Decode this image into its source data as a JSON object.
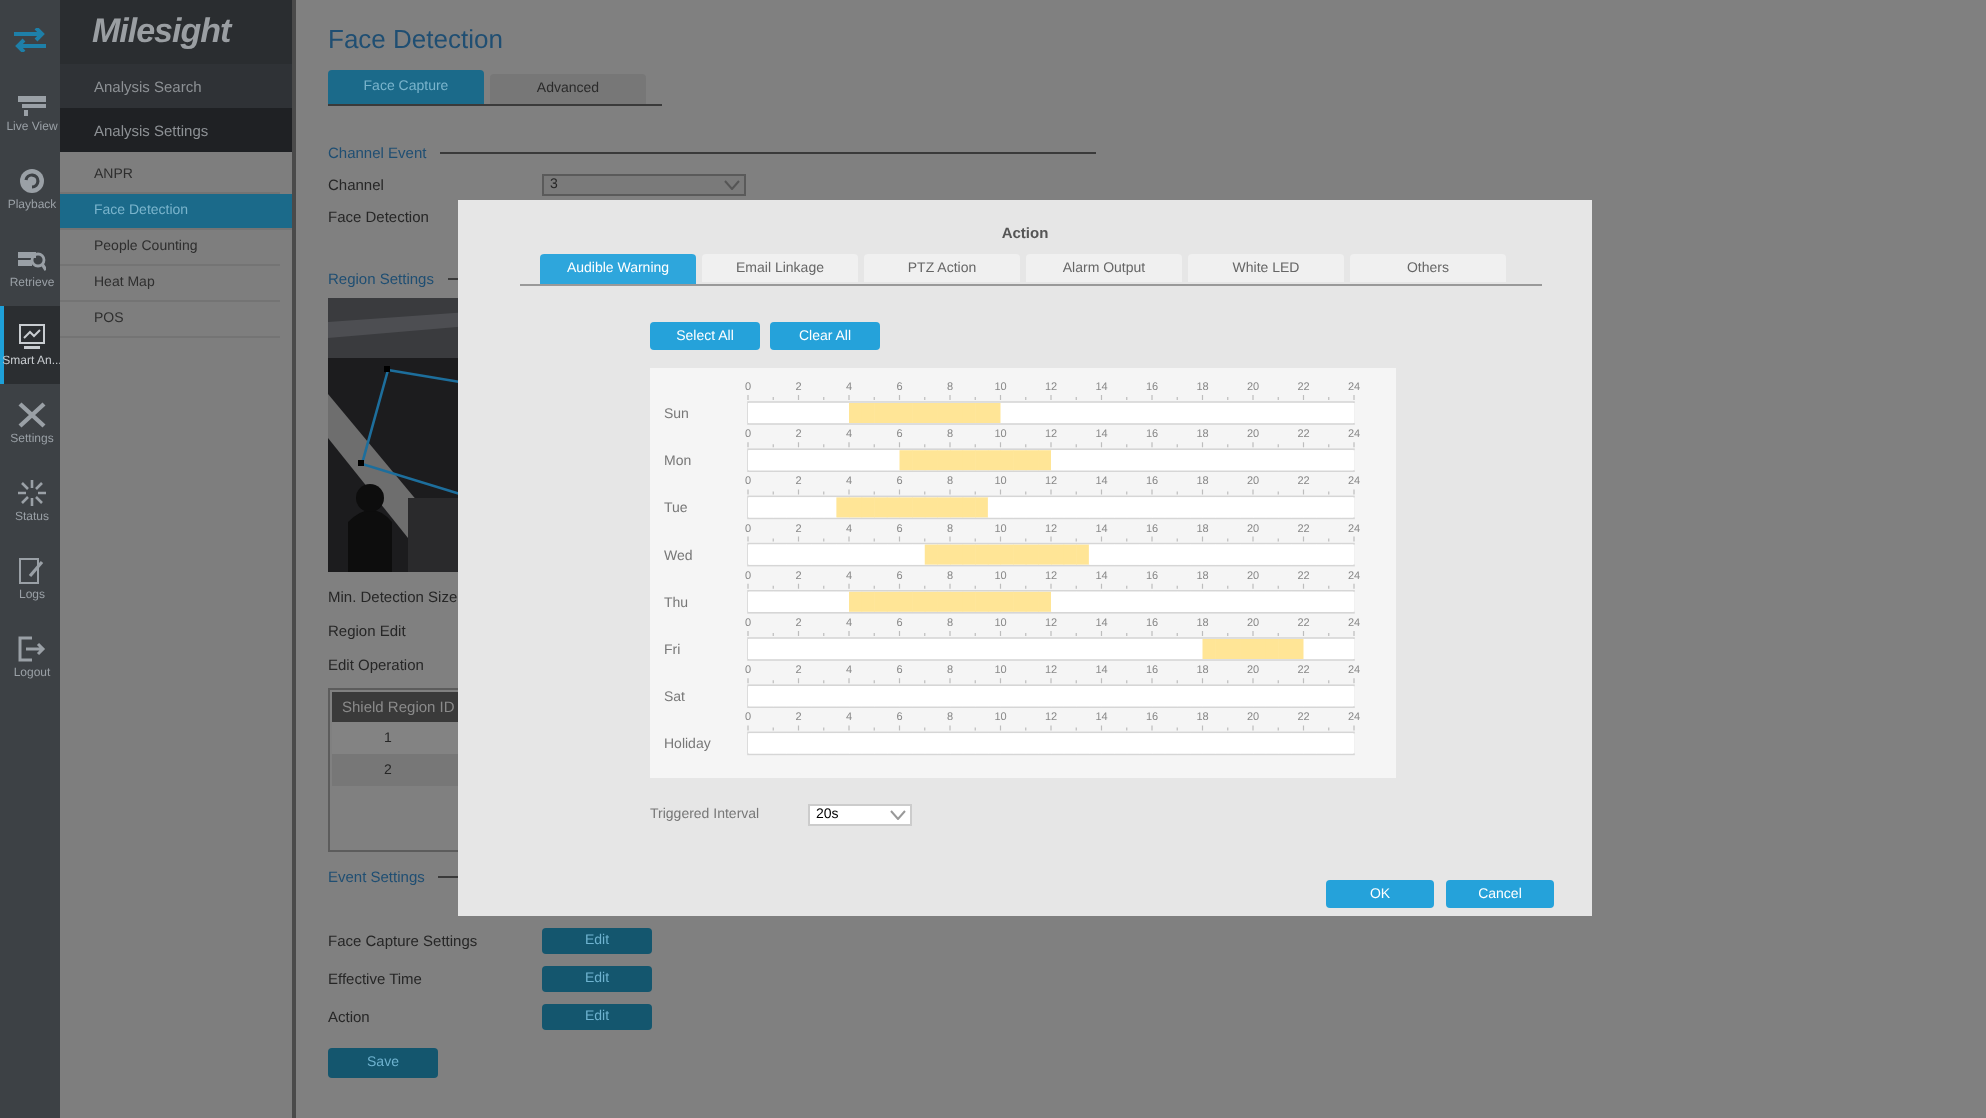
{
  "sidebar": {
    "items": [
      {
        "kind": "live",
        "label": "Live View",
        "selected": false
      },
      {
        "kind": "playback",
        "label": "Playback",
        "selected": false
      },
      {
        "kind": "retrieve",
        "label": "Retrieve",
        "selected": false
      },
      {
        "kind": "smart",
        "label": "Smart An...",
        "selected": true
      },
      {
        "kind": "settings",
        "label": "Settings",
        "selected": false
      },
      {
        "kind": "status",
        "label": "Status",
        "selected": false
      },
      {
        "kind": "logs",
        "label": "Logs",
        "selected": false
      },
      {
        "kind": "logout",
        "label": "Logout",
        "selected": false
      }
    ]
  },
  "menu": {
    "logo": "Milesight",
    "sections": [
      {
        "label": "Analysis Search",
        "selected": false
      },
      {
        "label": "Analysis Settings",
        "selected": true
      }
    ],
    "items": [
      {
        "label": "ANPR",
        "selected": false
      },
      {
        "label": "Face Detection",
        "selected": true
      },
      {
        "label": "People Counting",
        "selected": false
      },
      {
        "label": "Heat Map",
        "selected": false
      },
      {
        "label": "POS",
        "selected": false
      }
    ]
  },
  "page": {
    "title": "Face Detection",
    "tabs": [
      {
        "label": "Face Capture",
        "selected": true
      },
      {
        "label": "Advanced",
        "selected": false
      }
    ],
    "channel_event": {
      "heading": "Channel Event",
      "channel_label": "Channel",
      "channel_value": "3",
      "face_detection_label": "Face Detection"
    },
    "region_settings": {
      "heading": "Region Settings",
      "labels": [
        "Min. Detection Size",
        "Region Edit",
        "Edit Operation"
      ],
      "table": {
        "columns": [
          "Shield Region ID"
        ],
        "rows": [
          [
            "1"
          ],
          [
            "2"
          ]
        ]
      }
    },
    "event_settings": {
      "heading": "Event Settings",
      "rows": [
        {
          "label": "Face Capture Settings",
          "button": "Edit"
        },
        {
          "label": "Effective Time",
          "button": "Edit"
        },
        {
          "label": "Action",
          "button": "Edit"
        }
      ]
    },
    "save": "Save"
  },
  "dialog": {
    "title": "Action",
    "tabs": [
      {
        "label": "Audible Warning",
        "selected": true
      },
      {
        "label": "Email Linkage",
        "selected": false
      },
      {
        "label": "PTZ Action",
        "selected": false
      },
      {
        "label": "Alarm Output",
        "selected": false
      },
      {
        "label": "White LED",
        "selected": false
      },
      {
        "label": "Others",
        "selected": false
      }
    ],
    "buttons": [
      "Select All",
      "Clear All"
    ],
    "schedule": {
      "days": [
        {
          "label": "Sun",
          "ticks": [
            "0",
            "2",
            "4",
            "6",
            "8",
            "10",
            "12",
            "14",
            "16",
            "18",
            "20",
            "22",
            "24"
          ],
          "half_hours": [
            false,
            false,
            false,
            false,
            false,
            false,
            false,
            false,
            true,
            true,
            true,
            true,
            true,
            true,
            true,
            true,
            true,
            true,
            true,
            true,
            false,
            false,
            false,
            false,
            false,
            false,
            false,
            false,
            false,
            false,
            false,
            false,
            false,
            false,
            false,
            false,
            false,
            false,
            false,
            false,
            false,
            false,
            false,
            false,
            false,
            false,
            false,
            false
          ]
        },
        {
          "label": "Mon",
          "ticks": [
            "0",
            "2",
            "4",
            "6",
            "8",
            "10",
            "12",
            "14",
            "16",
            "18",
            "20",
            "22",
            "24"
          ],
          "half_hours": [
            false,
            false,
            false,
            false,
            false,
            false,
            false,
            false,
            false,
            false,
            false,
            false,
            true,
            true,
            true,
            true,
            true,
            true,
            true,
            true,
            true,
            true,
            true,
            true,
            false,
            false,
            false,
            false,
            false,
            false,
            false,
            false,
            false,
            false,
            false,
            false,
            false,
            false,
            false,
            false,
            false,
            false,
            false,
            false,
            false,
            false,
            false,
            false
          ]
        },
        {
          "label": "Tue",
          "ticks": [
            "0",
            "2",
            "4",
            "6",
            "8",
            "10",
            "12",
            "14",
            "16",
            "18",
            "20",
            "22",
            "24"
          ],
          "half_hours": [
            false,
            false,
            false,
            false,
            false,
            false,
            false,
            true,
            true,
            true,
            true,
            true,
            true,
            true,
            true,
            true,
            true,
            true,
            true,
            false,
            false,
            false,
            false,
            false,
            false,
            false,
            false,
            false,
            false,
            false,
            false,
            false,
            false,
            false,
            false,
            false,
            false,
            false,
            false,
            false,
            false,
            false,
            false,
            false,
            false,
            false,
            false,
            false
          ]
        },
        {
          "label": "Wed",
          "ticks": [
            "0",
            "2",
            "4",
            "6",
            "8",
            "10",
            "12",
            "14",
            "16",
            "18",
            "20",
            "22",
            "24"
          ],
          "half_hours": [
            false,
            false,
            false,
            false,
            false,
            false,
            false,
            false,
            false,
            false,
            false,
            false,
            false,
            false,
            true,
            true,
            true,
            true,
            true,
            true,
            true,
            true,
            true,
            true,
            true,
            true,
            true,
            false,
            false,
            false,
            false,
            false,
            false,
            false,
            false,
            false,
            false,
            false,
            false,
            false,
            false,
            false,
            false,
            false,
            false,
            false,
            false,
            false
          ]
        },
        {
          "label": "Thu",
          "ticks": [
            "0",
            "2",
            "4",
            "6",
            "8",
            "10",
            "12",
            "14",
            "16",
            "18",
            "20",
            "22",
            "24"
          ],
          "half_hours": [
            false,
            false,
            false,
            false,
            false,
            false,
            false,
            false,
            true,
            true,
            true,
            true,
            true,
            true,
            true,
            true,
            true,
            true,
            true,
            true,
            true,
            true,
            true,
            true,
            false,
            false,
            false,
            false,
            false,
            false,
            false,
            false,
            false,
            false,
            false,
            false,
            false,
            false,
            false,
            false,
            false,
            false,
            false,
            false,
            false,
            false,
            false,
            false
          ]
        },
        {
          "label": "Fri",
          "ticks": [
            "0",
            "2",
            "4",
            "6",
            "8",
            "10",
            "12",
            "14",
            "16",
            "18",
            "20",
            "22",
            "24"
          ],
          "half_hours": [
            false,
            false,
            false,
            false,
            false,
            false,
            false,
            false,
            false,
            false,
            false,
            false,
            false,
            false,
            false,
            false,
            false,
            false,
            false,
            false,
            false,
            false,
            false,
            false,
            false,
            false,
            false,
            false,
            false,
            false,
            false,
            false,
            false,
            false,
            false,
            false,
            true,
            true,
            true,
            true,
            true,
            true,
            true,
            true,
            false,
            false,
            false,
            false
          ]
        },
        {
          "label": "Sat",
          "ticks": [
            "0",
            "2",
            "4",
            "6",
            "8",
            "10",
            "12",
            "14",
            "16",
            "18",
            "20",
            "22",
            "24"
          ],
          "half_hours": [
            false,
            false,
            false,
            false,
            false,
            false,
            false,
            false,
            false,
            false,
            false,
            false,
            false,
            false,
            false,
            false,
            false,
            false,
            false,
            false,
            false,
            false,
            false,
            false,
            false,
            false,
            false,
            false,
            false,
            false,
            false,
            false,
            false,
            false,
            false,
            false,
            false,
            false,
            false,
            false,
            false,
            false,
            false,
            false,
            false,
            false,
            false,
            false
          ]
        },
        {
          "label": "Holiday",
          "ticks": [
            "0",
            "2",
            "4",
            "6",
            "8",
            "10",
            "12",
            "14",
            "16",
            "18",
            "20",
            "22",
            "24"
          ],
          "half_hours": [
            false,
            false,
            false,
            false,
            false,
            false,
            false,
            false,
            false,
            false,
            false,
            false,
            false,
            false,
            false,
            false,
            false,
            false,
            false,
            false,
            false,
            false,
            false,
            false,
            false,
            false,
            false,
            false,
            false,
            false,
            false,
            false,
            false,
            false,
            false,
            false,
            false,
            false,
            false,
            false,
            false,
            false,
            false,
            false,
            false,
            false,
            false,
            false
          ]
        }
      ]
    },
    "interval": {
      "label": "Triggered Interval",
      "value": "20s"
    },
    "footer": [
      "OK",
      "Cancel"
    ]
  }
}
